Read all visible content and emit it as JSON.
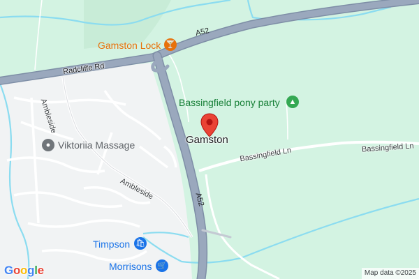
{
  "map": {
    "place_label": "Gamston",
    "pois": {
      "gamston_lock": {
        "label": "Gamston Lock",
        "icon": "cocktail-icon",
        "color": "#e8710a"
      },
      "pony_party": {
        "label": "Bassingfield pony party",
        "icon": "tree-icon",
        "color": "#34a853"
      },
      "viktoriia": {
        "label": "Viktoriia Massage",
        "icon": "circle-dot-icon",
        "color": "#70757a"
      },
      "timpson": {
        "label": "Timpson",
        "icon": "shopping-bag-icon",
        "color": "#1a73e8"
      },
      "morrisons": {
        "label": "Morrisons",
        "icon": "shopping-cart-icon",
        "color": "#1a73e8"
      }
    },
    "roads": {
      "a52_north": "A52",
      "a52_south": "A52",
      "radcliffe": "Radcliffe Rd",
      "ambleside_vertical": "Ambleside",
      "ambleside": "Ambleside",
      "bassingfield_west": "Bassingfield Ln",
      "bassingfield_east": "Bassingfield Ln"
    },
    "attribution": "Map data ©2025",
    "logo": "Google",
    "colors": {
      "green_land": "#d6f4e4",
      "urban": "#f1f3f4",
      "highway": "#8d9cb3",
      "water": "#8bdcf0",
      "pin": "#ea4335"
    }
  }
}
